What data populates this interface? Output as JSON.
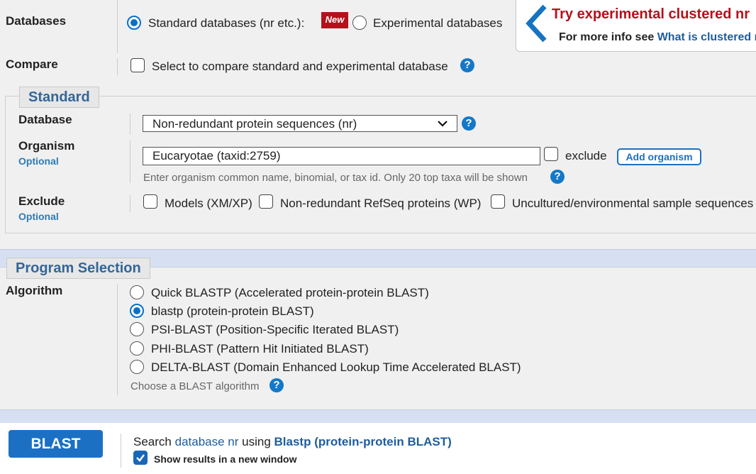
{
  "databases": {
    "label": "Databases",
    "standard_label": "Standard databases (nr etc.):",
    "new_badge": "New",
    "experimental_label": "Experimental databases"
  },
  "promo": {
    "title": "Try experimental clustered nr",
    "info_prefix": "For more info see",
    "info_link": "What is clustered nr"
  },
  "compare": {
    "label": "Compare",
    "checkbox_label": "Select to compare standard and experimental database"
  },
  "standard": {
    "legend": "Standard",
    "database_label": "Database",
    "database_value": "Non-redundant protein sequences (nr)",
    "organism_label": "Organism",
    "organism_optional": "Optional",
    "organism_value": "Eucaryotae (taxid:2759)",
    "exclude_label": "exclude",
    "add_organism": "Add organism",
    "organism_hint": "Enter organism common name, binomial, or tax id. Only 20 top taxa will be shown",
    "exclude_section_label": "Exclude",
    "exclude_optional": "Optional",
    "exclude_models": "Models (XM/XP)",
    "exclude_refseq": "Non-redundant RefSeq proteins (WP)",
    "exclude_uncultured": "Uncultured/environmental sample sequences"
  },
  "program": {
    "legend": "Program Selection",
    "algorithm_label": "Algorithm",
    "options": [
      {
        "label": "Quick BLASTP (Accelerated protein-protein BLAST)",
        "selected": false
      },
      {
        "label": "blastp (protein-protein BLAST)",
        "selected": true
      },
      {
        "label": "PSI-BLAST (Position-Specific Iterated BLAST)",
        "selected": false
      },
      {
        "label": "PHI-BLAST (Pattern Hit Initiated BLAST)",
        "selected": false
      },
      {
        "label": "DELTA-BLAST (Domain Enhanced Lookup Time Accelerated BLAST)",
        "selected": false
      }
    ],
    "hint": "Choose a BLAST algorithm"
  },
  "submit": {
    "button": "BLAST",
    "search_prefix": "Search",
    "search_db": "database nr",
    "using": "using",
    "program": "Blastp (protein-protein BLAST)",
    "new_window_label": "Show results in a new window"
  },
  "help_glyph": "?",
  "colors": {
    "accent": "#1478c8",
    "title_red": "#b3121c",
    "legend_blue": "#336699",
    "button_blue": "#1b70c4"
  }
}
